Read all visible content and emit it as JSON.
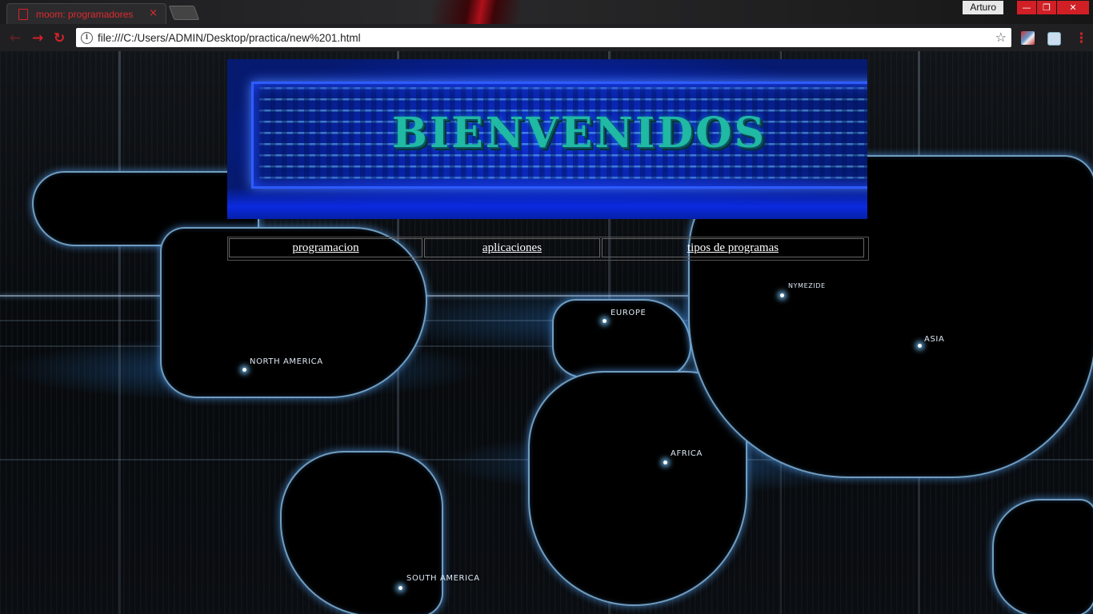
{
  "browser": {
    "tab_title": "moom: programadores",
    "tab_close": "×",
    "profile_name": "Arturo",
    "address_url": "file:///C:/Users/ADMIN/Desktop/practica/new%201.html",
    "info_glyph": "i",
    "star_glyph": "☆",
    "back_glyph": "←",
    "forward_glyph": "→",
    "reload_glyph": "↻",
    "menu_glyph": "⋮",
    "minimize_glyph": "—",
    "restore_glyph": "❐",
    "close_glyph": "✕",
    "accent_color": "#d8222a"
  },
  "page": {
    "banner_text": "BIENVENIDOS",
    "menu": [
      {
        "label": "programacion"
      },
      {
        "label": "aplicaciones"
      },
      {
        "label": "tipos de programas"
      }
    ],
    "map_labels": {
      "north_america": "NORTH AMERICA",
      "south_america": "SOUTH AMERICA",
      "europe": "EUROPE",
      "africa": "AFRICA",
      "asia": "ASIA",
      "nymezide": "NYMEZIDE"
    }
  }
}
